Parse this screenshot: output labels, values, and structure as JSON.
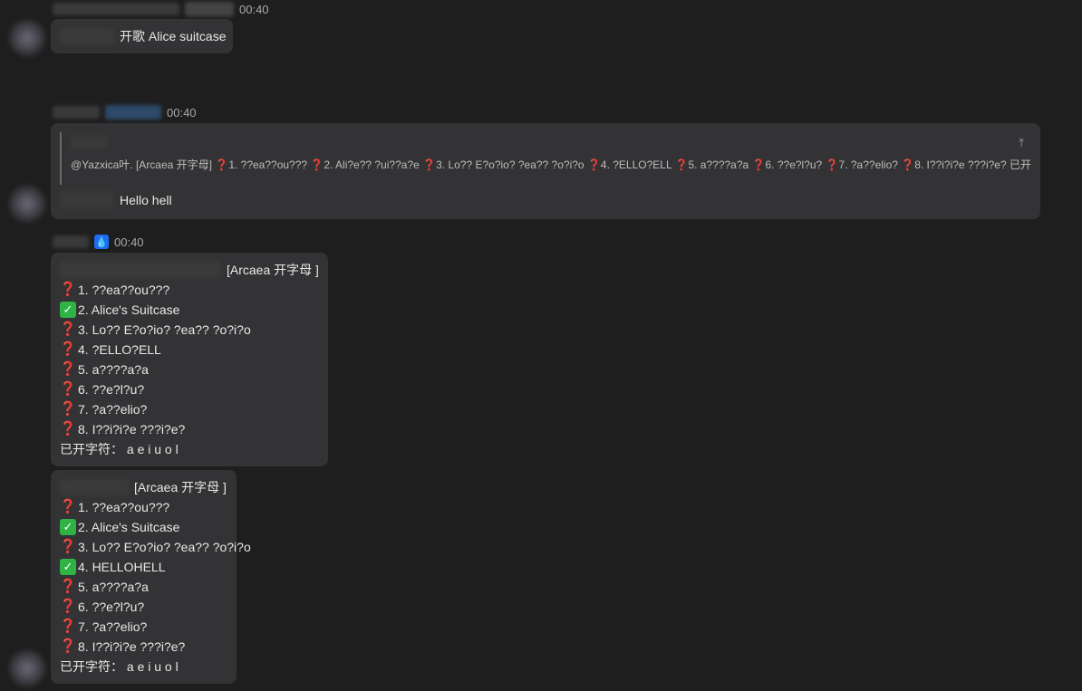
{
  "messages": {
    "m1": {
      "time": "00:40",
      "text": "开歌 Alice suitcase"
    },
    "m2": {
      "time": "00:40",
      "reply_text": "@Yazxica叶. [Arcaea 开字母]",
      "reply_items": [
        "1. ??ea??ou???",
        "2. Ali?e?? ?ui??a?e",
        "3. Lo?? E?o?io? ?ea?? ?o?i?o",
        "4. ?ELLO?ELL",
        "5. a????a?a",
        "6. ??e?l?u?",
        "7. ?a??elio?",
        "8. I??i?i?e ???i?e?"
      ],
      "reply_tail": "已开字符： a e i u o l",
      "text": "Hello hell"
    },
    "m3": {
      "time": "00:40",
      "badge_icon": "drop-icon",
      "header": "[Arcaea 开字母 ]",
      "items": [
        {
          "status": "unknown",
          "text": "1. ??ea??ou???"
        },
        {
          "status": "solved",
          "text": "2. Alice's Suitcase"
        },
        {
          "status": "unknown",
          "text": "3. Lo?? E?o?io? ?ea?? ?o?i?o"
        },
        {
          "status": "unknown",
          "text": "4. ?ELLO?ELL"
        },
        {
          "status": "unknown",
          "text": "5. a????a?a"
        },
        {
          "status": "unknown",
          "text": "6. ??e?l?u?"
        },
        {
          "status": "unknown",
          "text": "7. ?a??elio?"
        },
        {
          "status": "unknown",
          "text": "8. I??i?i?e ???i?e?"
        }
      ],
      "footer": "已开字符： a e i u o l"
    },
    "m4": {
      "header": "[Arcaea 开字母 ]",
      "items": [
        {
          "status": "unknown",
          "text": "1. ??ea??ou???"
        },
        {
          "status": "solved",
          "text": "2. Alice's Suitcase"
        },
        {
          "status": "unknown",
          "text": "3. Lo?? E?o?io? ?ea?? ?o?i?o"
        },
        {
          "status": "solved",
          "text": "4. HELLOHELL"
        },
        {
          "status": "unknown",
          "text": "5. a????a?a"
        },
        {
          "status": "unknown",
          "text": "6. ??e?l?u?"
        },
        {
          "status": "unknown",
          "text": "7. ?a??elio?"
        },
        {
          "status": "unknown",
          "text": "8. I??i?i?e ???i?e?"
        }
      ],
      "footer": "已开字符： a e i u o l"
    }
  },
  "icons": {
    "unknown": "question-mark-icon",
    "solved": "check-mark-icon",
    "pin": "scroll-to-top-icon"
  },
  "colors": {
    "background": "#1e1e1e",
    "bubble": "#333335",
    "unknown": "#e03131",
    "solved": "#2fb344",
    "badge": "#1e6cf0"
  }
}
